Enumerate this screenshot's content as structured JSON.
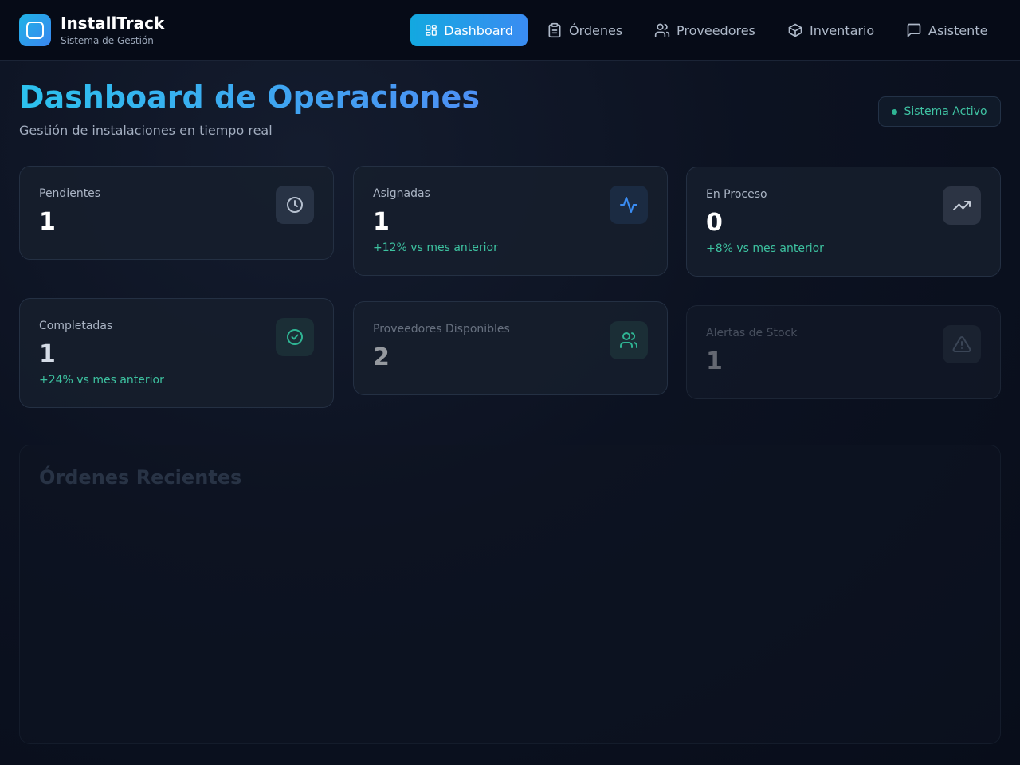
{
  "brand": {
    "name": "InstallTrack",
    "subtitle": "Sistema de Gestión"
  },
  "nav": [
    {
      "label": "Dashboard",
      "icon": "dashboard-icon",
      "active": true
    },
    {
      "label": "Órdenes",
      "icon": "clipboard-icon",
      "active": false
    },
    {
      "label": "Proveedores",
      "icon": "users-icon",
      "active": false
    },
    {
      "label": "Inventario",
      "icon": "package-icon",
      "active": false
    },
    {
      "label": "Asistente",
      "icon": "chat-icon",
      "active": false
    }
  ],
  "header": {
    "title": "Dashboard de Operaciones",
    "subtitle": "Gestión de instalaciones en tiempo real",
    "status": "Sistema Activo"
  },
  "stats": [
    {
      "label": "Pendientes",
      "value": "1",
      "trend": "",
      "icon": "clock-icon"
    },
    {
      "label": "Asignadas",
      "value": "1",
      "trend": "+12% vs mes anterior",
      "icon": "activity-icon"
    },
    {
      "label": "En Proceso",
      "value": "0",
      "trend": "+8% vs mes anterior",
      "icon": "trending-up-icon"
    },
    {
      "label": "Completadas",
      "value": "1",
      "trend": "+24% vs mes anterior",
      "icon": "check-circle-icon"
    },
    {
      "label": "Proveedores Disponibles",
      "value": "2",
      "trend": "",
      "icon": "users-icon"
    },
    {
      "label": "Alertas de Stock",
      "value": "1",
      "trend": "",
      "icon": "alert-triangle-icon"
    }
  ],
  "recent_orders": {
    "title": "Órdenes Recientes"
  },
  "colors": {
    "accent": "#2a9cea",
    "success": "#3dc2a0",
    "background": "#0c1221"
  }
}
